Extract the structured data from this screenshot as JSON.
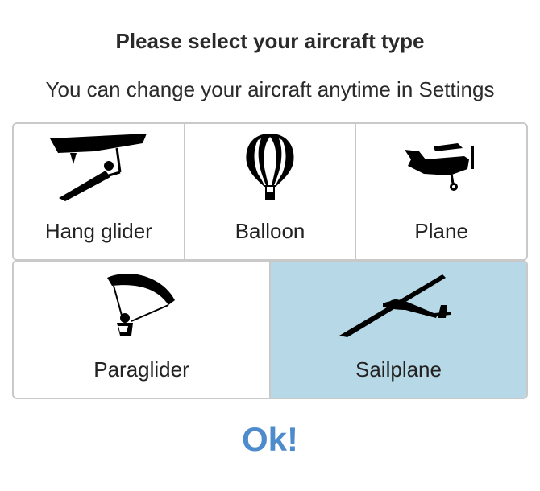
{
  "dialog": {
    "title": "Please select your aircraft type",
    "subtitle": "You can change your aircraft anytime in Settings",
    "ok_label": "Ok!"
  },
  "aircraft_options": [
    {
      "label": "Hang glider",
      "icon": "hang-glider-icon",
      "selected": false
    },
    {
      "label": "Balloon",
      "icon": "balloon-icon",
      "selected": false
    },
    {
      "label": "Plane",
      "icon": "plane-icon",
      "selected": false
    },
    {
      "label": "Paraglider",
      "icon": "paraglider-icon",
      "selected": false
    },
    {
      "label": "Sailplane",
      "icon": "sailplane-icon",
      "selected": true
    }
  ],
  "colors": {
    "selected_background": "#b7d8e6",
    "ok_text": "#4d8bcc",
    "border": "#c9c9c9"
  }
}
